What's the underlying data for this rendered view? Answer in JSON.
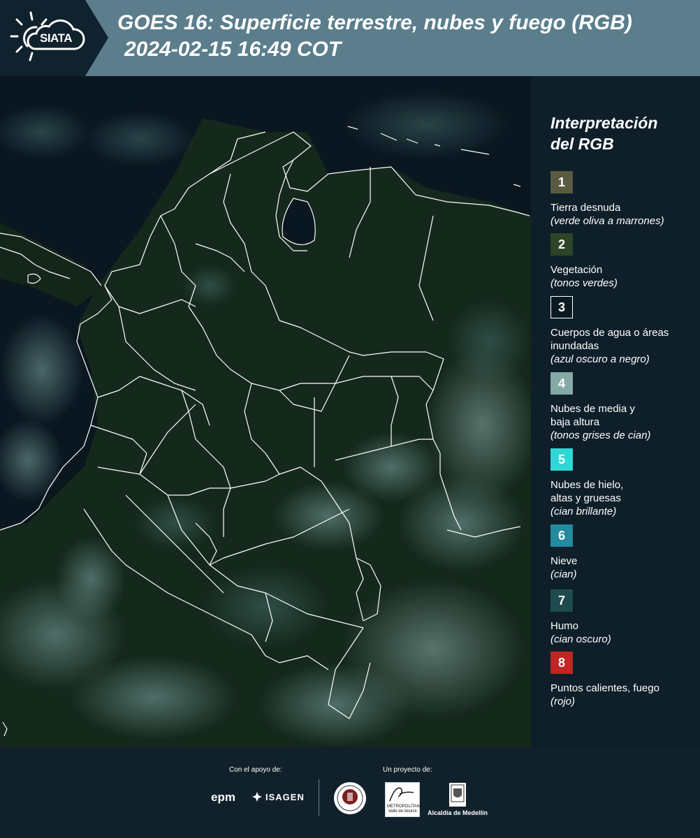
{
  "header": {
    "logo_text": "SIATA",
    "title_line1": "GOES 16: Superficie terrestre, nubes y fuego (RGB)",
    "title_line2": "2024-02-15 16:49 COT"
  },
  "legend": {
    "title_line1": "Interpretación",
    "title_line2": "del RGB",
    "items": [
      {
        "num": "1",
        "label": "Tierra desnuda",
        "sub": "(verde oliva a marrones)",
        "color": "#5a5a40"
      },
      {
        "num": "2",
        "label": "Vegetación",
        "sub": "(tonos verdes)",
        "color": "#2d4427"
      },
      {
        "num": "3",
        "label": "Cuerpos de agua o áreas inundadas",
        "sub": "(azul oscuro a negro)",
        "color": "#0b1a22"
      },
      {
        "num": "4",
        "label": "Nubes de media y baja altura",
        "sub": "(tonos grises de cian)",
        "color": "#85aaa6"
      },
      {
        "num": "5",
        "label": "Nubes de hielo, altas y gruesas",
        "sub": "(cian brillante)",
        "color": "#2ed8d7"
      },
      {
        "num": "6",
        "label": "Nieve",
        "sub": "(cian)",
        "color": "#248aa0"
      },
      {
        "num": "7",
        "label": "Humo",
        "sub": "(cian oscuro)",
        "color": "#1f4b4f"
      },
      {
        "num": "8",
        "label": "Puntos calientes, fuego",
        "sub": "(rojo)",
        "color": "#c32424"
      }
    ]
  },
  "footer": {
    "support_label": "Con el apoyo de:",
    "project_label": "Un proyecto de:",
    "epm": "epm",
    "isagen": "ISAGEN",
    "area_text": "METROPOLITANA",
    "area_sub": "Valle de Aburrá",
    "alcaldia": "Alcaldía de Medellín"
  }
}
